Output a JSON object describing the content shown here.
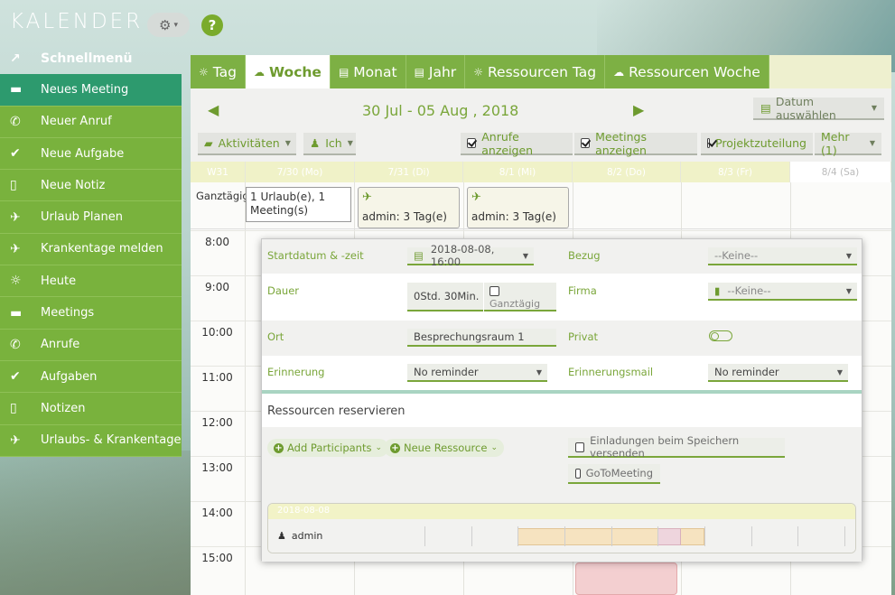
{
  "app": {
    "title": "KALENDER",
    "help": "?"
  },
  "sidebar": {
    "items": [
      {
        "label": "Schnellmenü",
        "icon": "trending-icon"
      },
      {
        "label": "Neues Meeting",
        "icon": "meeting-icon"
      },
      {
        "label": "Neuer Anruf",
        "icon": "phone-icon"
      },
      {
        "label": "Neue Aufgabe",
        "icon": "task-check-icon"
      },
      {
        "label": "Neue Notiz",
        "icon": "note-icon"
      },
      {
        "label": "Urlaub Planen",
        "icon": "plane-icon"
      },
      {
        "label": "Krankentage melden",
        "icon": "plane-icon"
      },
      {
        "label": "Heute",
        "icon": "sun-icon"
      },
      {
        "label": "Meetings",
        "icon": "meeting-icon"
      },
      {
        "label": "Anrufe",
        "icon": "phone-icon"
      },
      {
        "label": "Aufgaben",
        "icon": "task-check-icon"
      },
      {
        "label": "Notizen",
        "icon": "note-icon"
      },
      {
        "label": "Urlaubs- & Krankentage",
        "icon": "plane-icon"
      }
    ]
  },
  "tabs": [
    {
      "label": "Tag"
    },
    {
      "label": "Woche"
    },
    {
      "label": "Monat"
    },
    {
      "label": "Jahr"
    },
    {
      "label": "Ressourcen Tag"
    },
    {
      "label": "Ressourcen Woche"
    }
  ],
  "nav": {
    "range": "30 Jul - 05 Aug , 2018",
    "date_picker": "Datum auswählen"
  },
  "filters": {
    "aktivitaeten": "Aktivitäten",
    "ich": "Ich",
    "anrufe": "Anrufe anzeigen",
    "meetings": "Meetings anzeigen",
    "projekt": "Projektzuteilung",
    "mehr": "Mehr (1)"
  },
  "calendar": {
    "week_label": "W31",
    "days": [
      "7/30 (Mo)",
      "7/31 (Di)",
      "8/1 (Mi)",
      "8/2 (Do)",
      "8/3 (Fr)",
      "8/4 (Sa)"
    ],
    "allday_label": "Ganztägig",
    "hours": [
      "8:00",
      "9:00",
      "10:00",
      "11:00",
      "12:00",
      "13:00",
      "14:00",
      "15:00"
    ],
    "allday_events": [
      {
        "text": "1 Urlaub(e), 1 Meeting(s)"
      },
      {
        "text": "admin: 3 Tag(e)"
      },
      {
        "text": "admin: 3 Tag(e)"
      }
    ]
  },
  "popup": {
    "start_label": "Startdatum & -zeit",
    "start_value": "2018-08-08, 16:00",
    "bezug_label": "Bezug",
    "bezug_value": "--Keine--",
    "dauer_label": "Dauer",
    "dauer_value": "0Std. 30Min.",
    "ganztaegig": "Ganztägig",
    "firma_label": "Firma",
    "firma_value": "--Keine--",
    "ort_label": "Ort",
    "ort_value": "Besprechungsraum 1",
    "privat_label": "Privat",
    "erinnerung_label": "Erinnerung",
    "erinnerung_value": "No reminder",
    "erinnerungsmail_label": "Erinnerungsmail",
    "erinnerungsmail_value": "No reminder",
    "ressourcen_title": "Ressourcen reservieren",
    "add_participants": "Add Participants",
    "neue_ressource": "Neue Ressource",
    "einladungen": "Einladungen beim Speichern versenden",
    "gotomeeting": "GoToMeeting",
    "sched_date": "2018-08-08",
    "sched_user": "admin"
  }
}
